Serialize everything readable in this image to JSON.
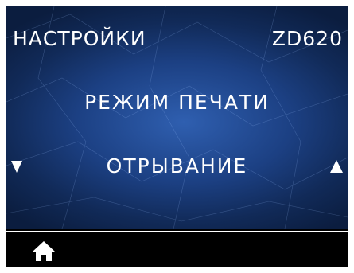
{
  "header": {
    "title": "НАСТРОЙКИ",
    "model": "ZD620"
  },
  "menu": {
    "label": "РЕЖИМ ПЕЧАТИ",
    "value": "ОТРЫВАНИЕ"
  },
  "navigation": {
    "prev_icon": "triangle-down-icon",
    "next_icon": "triangle-up-icon",
    "home_icon": "home-icon"
  },
  "colors": {
    "screen_background": "#000000",
    "gradient_center": "#2f5fb0",
    "gradient_edge": "#0b1d3f",
    "text": "#ffffff"
  }
}
